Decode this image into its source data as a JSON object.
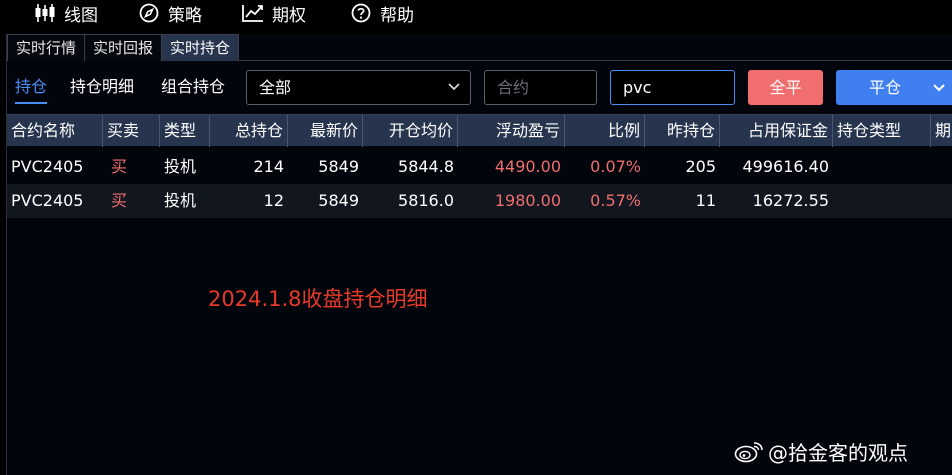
{
  "menu": [
    {
      "label": "线图",
      "icon": "candlestick-chart-icon"
    },
    {
      "label": "策略",
      "icon": "compass-icon"
    },
    {
      "label": "期权",
      "icon": "line-chart-icon"
    },
    {
      "label": "帮助",
      "icon": "help-circle-icon"
    }
  ],
  "tabs": [
    "实时行情",
    "实时回报",
    "实时持仓"
  ],
  "active_tab": "实时持仓",
  "sub_tabs": [
    "持仓",
    "持仓明细",
    "组合持仓"
  ],
  "active_sub_tab": "持仓",
  "filter": {
    "category_value": "全部",
    "contract_placeholder": "合约",
    "search_value": "pvc"
  },
  "buttons": {
    "close_all": "全平",
    "close": "平仓"
  },
  "table": {
    "columns": [
      "合约名称",
      "买卖",
      "类型",
      "总持仓",
      "最新价",
      "开仓均价",
      "浮动盈亏",
      "比例",
      "昨持仓",
      "占用保证金",
      "持仓类型",
      "期"
    ],
    "rows": [
      {
        "contract": "PVC2405",
        "side": "买",
        "type": "投机",
        "total": "214",
        "last": "5849",
        "avg_open": "5844.8",
        "float_pnl": "4490.00",
        "ratio": "0.07%",
        "yesterday": "205",
        "margin": "499616.40"
      },
      {
        "contract": "PVC2405",
        "side": "买",
        "type": "投机",
        "total": "12",
        "last": "5849",
        "avg_open": "5816.0",
        "float_pnl": "1980.00",
        "ratio": "0.57%",
        "yesterday": "11",
        "margin": "16272.55"
      }
    ]
  },
  "annotation": "2024.1.8收盘持仓明细",
  "watermark": "@拾金客的观点",
  "colors": {
    "accent_blue": "#3f7ff0",
    "profit_red": "#f06e6e",
    "header_bg": "#26344e",
    "annotation_red": "#e83a2a"
  }
}
